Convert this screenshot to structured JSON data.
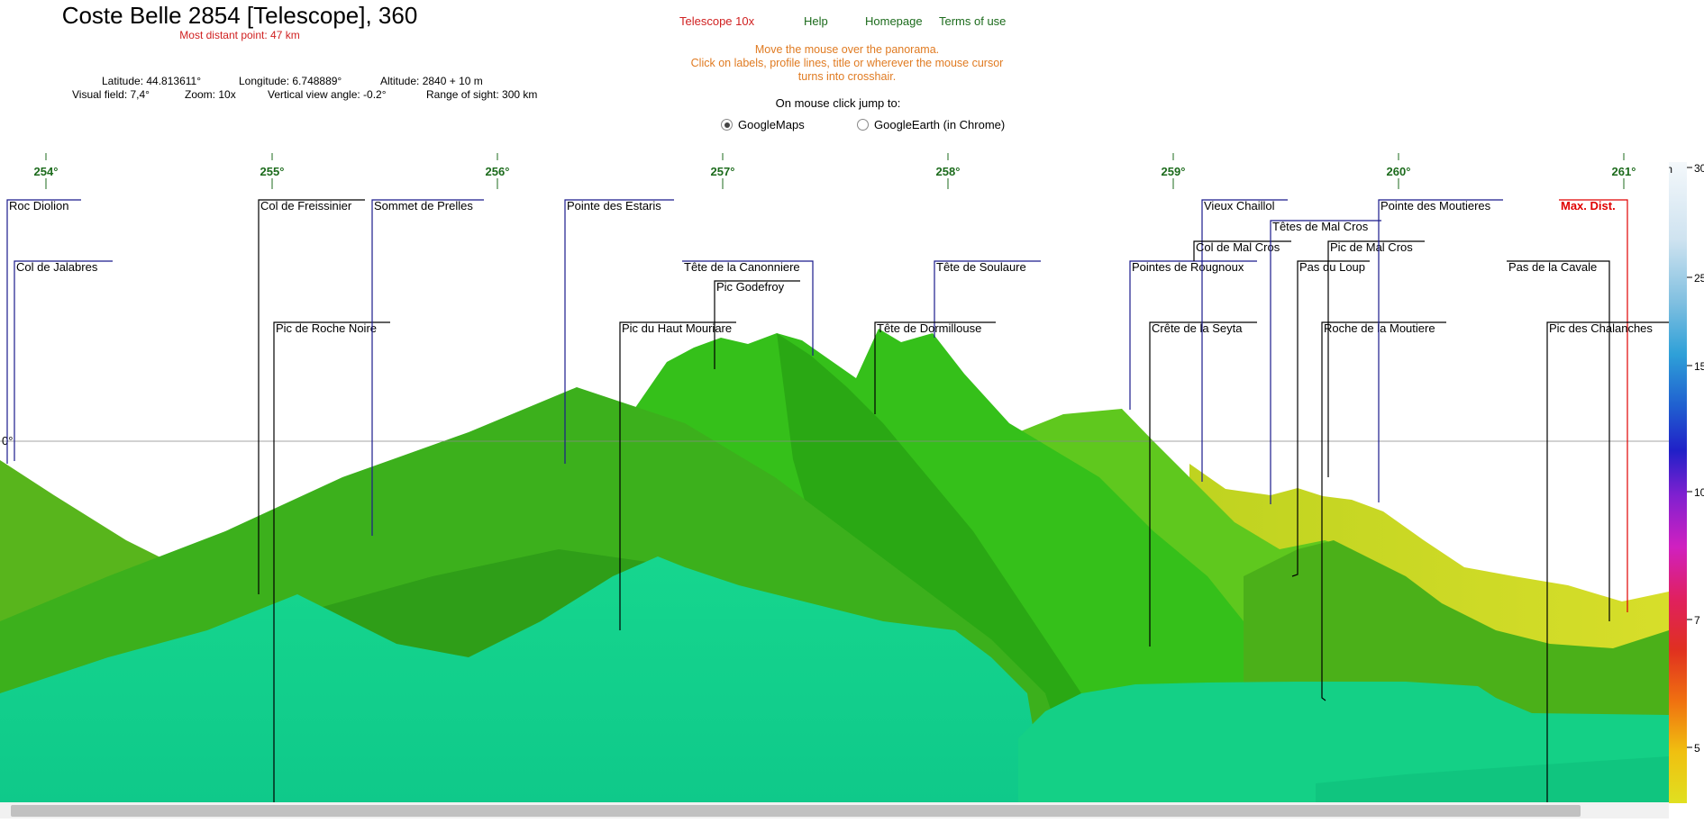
{
  "header": {
    "title": "Coste Belle 2854 [Telescope], 360",
    "subtitle": "Most distant point: 47 km",
    "latitude": "Latitude: 44.813611°",
    "longitude": "Longitude: 6.748889°",
    "altitude": "Altitude: 2840 + 10 m",
    "visual_field": "Visual field: 7,4°",
    "zoom": "Zoom: 10x",
    "vertical_angle": "Vertical view angle: -0.2°",
    "range": "Range of sight: 300 km"
  },
  "nav": {
    "telescope": "Telescope 10x",
    "help": "Help",
    "homepage": "Homepage",
    "terms": "Terms of use"
  },
  "hint": {
    "line1": "Move the mouse over the panorama.",
    "line2": "Click on labels, profile lines, title or wherever the mouse cursor",
    "line3": "turns into crosshair."
  },
  "jump": {
    "label": "On mouse click jump to:",
    "options": [
      {
        "label": "GoogleMaps",
        "selected": true
      },
      {
        "label": "GoogleEarth (in Chrome)",
        "selected": false
      }
    ]
  },
  "panorama": {
    "horizon_label": "0°",
    "degrees": [
      "254°",
      "255°",
      "256°",
      "257°",
      "258°",
      "259°",
      "260°",
      "261°"
    ],
    "peaks": [
      "Roc Diolion",
      "Col de Jalabres",
      "Col de Freissinier",
      "Pic de Roche Noire",
      "Sommet de Prelles",
      "Pointe des Estaris",
      "Pic du Haut Mouriare",
      "Tête de la Canonniere",
      "Pic Godefroy",
      "Tête de Soulaure",
      "Tête de Dormillouse",
      "Pointes de Rougnoux",
      "Crête de la Seyta",
      "Vieux Chaillol",
      "Col de Mal Cros",
      "Têtes de Mal Cros",
      "Pic de Mal Cros",
      "Pas du Loup",
      "Roche de la Moutiere",
      "Pointe des Moutieres",
      "Max. Dist.",
      "Pas de la Cavale",
      "Pic des Chalanches"
    ]
  },
  "colorbar": {
    "unit": "km",
    "ticks": [
      "30",
      "25",
      "15",
      "10",
      "7",
      "5"
    ]
  },
  "colors": {
    "label_line_blue": "#1a1a8c",
    "label_line_black": "#000000",
    "max_dist_red": "#e00000",
    "nav_red": "#d02020",
    "nav_green": "#1c6b1c",
    "hint_orange": "#e07b22"
  }
}
